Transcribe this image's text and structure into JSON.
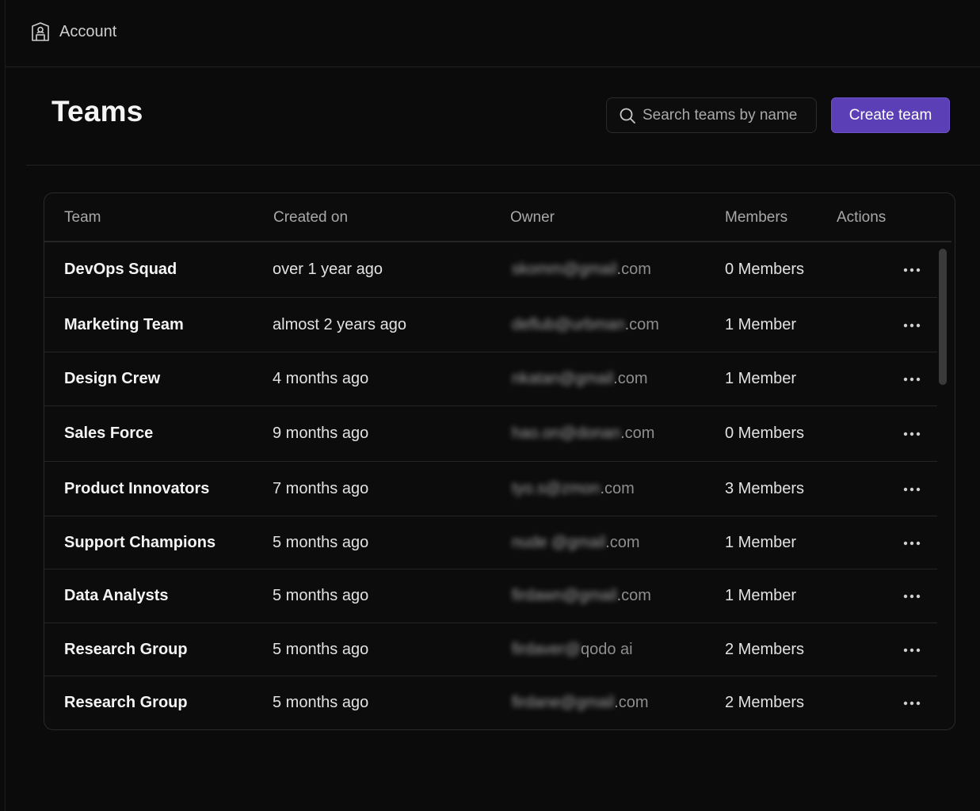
{
  "topbar": {
    "account_label": "Account"
  },
  "header": {
    "title": "Teams",
    "search_placeholder": "Search teams by name",
    "create_button": "Create team"
  },
  "table": {
    "columns": [
      "Team",
      "Created on",
      "Owner",
      "Members",
      "Actions"
    ],
    "rows": [
      {
        "team": "DevOps Squad",
        "created": "over 1 year ago",
        "owner_blur": "skomm@gmail",
        "owner_suffix": ".com",
        "members": "0 Members"
      },
      {
        "team": "Marketing Team",
        "created": "almost 2 years ago",
        "owner_blur": "deflub@urbman",
        "owner_suffix": ".com",
        "members": "1 Member"
      },
      {
        "team": "Design Crew",
        "created": "4 months ago",
        "owner_blur": "nkatan@gmail",
        "owner_suffix": ".com",
        "members": "1 Member"
      },
      {
        "team": "Sales Force",
        "created": "9 months ago",
        "owner_blur": "hao.on@donan",
        "owner_suffix": ".com",
        "members": "0 Members"
      },
      {
        "team": "Product Innovators",
        "created": "7 months ago",
        "owner_blur": "tyo.s@zmon",
        "owner_suffix": ".com",
        "members": "3 Members"
      },
      {
        "team": "Support Champions",
        "created": "5 months ago",
        "owner_blur": "nude @gmail",
        "owner_suffix": ".com",
        "members": "1 Member"
      },
      {
        "team": "Data Analysts",
        "created": "5 months ago",
        "owner_blur": "firdawn@gmail",
        "owner_suffix": ".com",
        "members": "1 Member"
      },
      {
        "team": "Research Group",
        "created": "5 months ago",
        "owner_blur": "firdaver@",
        "owner_suffix": "qodo ai",
        "members": "2 Members"
      },
      {
        "team": "Research Group",
        "created": "5 months ago",
        "owner_blur": "firdane@gmail",
        "owner_suffix": ".com",
        "members": "2 Members"
      }
    ]
  },
  "icons": {
    "account": "account-building-icon",
    "search": "search-icon",
    "more": "more-horizontal-icon"
  },
  "colors": {
    "background": "#0b0b0b",
    "accent": "#5b3fb6"
  }
}
